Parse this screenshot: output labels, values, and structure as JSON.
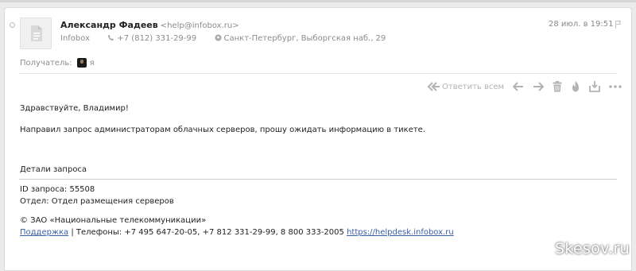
{
  "email": {
    "sender_name": "Александр Фадеев",
    "sender_email": "<help@infobox.ru>",
    "date": "28 июл. в 19:51",
    "company": "Infobox",
    "phone": "+7 (812) 331-29-99",
    "address": "Санкт-Петербург, Выборгская наб., 29",
    "recipient_label": "Получатель:",
    "recipient_name": "я"
  },
  "toolbar": {
    "forward_all_label": "Ответить всем"
  },
  "body": {
    "greeting": "Здравствуйте, Владимир!",
    "message": "Направил запрос администраторам облачных серверов, прошу ожидать информацию в тикете.",
    "details_title": "Детали запроса",
    "request_id": "ID запроса: 55508",
    "department": "Отдел: Отдел размещения серверов",
    "copyright": "© ЗАО «Национальные телекоммуникации»",
    "support_link": "Поддержка",
    "phones": " | Телефоны: +7 495 647-20-05, +7 812 331-29-99, 8 800 333-2005 ",
    "helpdesk_url": "https://helpdesk.infobox.ru"
  },
  "watermark": "Skesov.ru",
  "colors": {
    "background": "#ebebeb",
    "link": "#3a5fa8",
    "muted": "#8c8c8c",
    "icon_gray": "#b3b3b3"
  }
}
